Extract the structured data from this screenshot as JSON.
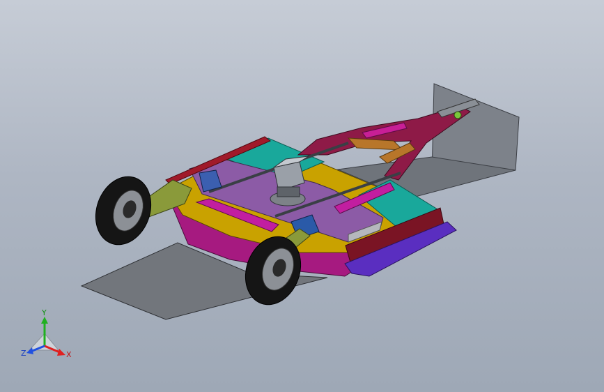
{
  "viewport": {
    "background_top": "#c6ccd6",
    "background_bottom": "#9ea8b6"
  },
  "triad": {
    "x_label": "X",
    "y_label": "Y",
    "z_label": "Z",
    "x_color": "#e02020",
    "y_color": "#20b020",
    "z_color": "#2050e0"
  },
  "model": {
    "parts": [
      {
        "name": "front-ground-plate",
        "color": "#74787d"
      },
      {
        "name": "rear-vertical-plate",
        "color": "#7b8087"
      },
      {
        "name": "mower-deck",
        "color": "#c8a400"
      },
      {
        "name": "deck-skirt",
        "color": "#b0208a"
      },
      {
        "name": "deck-top-cover",
        "color": "#8f5aa8"
      },
      {
        "name": "teal-shield",
        "color": "#1aa69a"
      },
      {
        "name": "hitch-frame",
        "color": "#9a1a4a"
      },
      {
        "name": "gearbox",
        "color": "#9aa0a6"
      },
      {
        "name": "rear-skid",
        "color": "#6a2ec4"
      },
      {
        "name": "wheels",
        "color": "#1a1a1a"
      }
    ]
  }
}
